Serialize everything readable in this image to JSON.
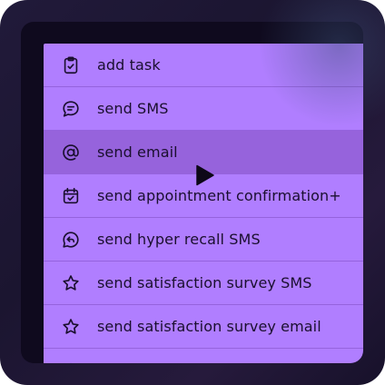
{
  "menu": {
    "items": [
      {
        "label": "add task",
        "icon": "clipboard-check-icon"
      },
      {
        "label": "send SMS",
        "icon": "message-icon"
      },
      {
        "label": "send email",
        "icon": "at-sign-icon"
      },
      {
        "label": "send appointment confirmation+",
        "icon": "calendar-check-icon"
      },
      {
        "label": "send hyper recall SMS",
        "icon": "message-reply-icon"
      },
      {
        "label": "send satisfaction survey SMS",
        "icon": "star-icon"
      },
      {
        "label": "send satisfaction survey email",
        "icon": "star-icon"
      },
      {
        "label": "",
        "icon": "partial-icon"
      }
    ],
    "hovered_item": "send email"
  },
  "colors": {
    "menu_background": "#b07eff",
    "hover_background": "#9663dc",
    "text": "#1a0f2e",
    "frame": "#1b1530"
  }
}
